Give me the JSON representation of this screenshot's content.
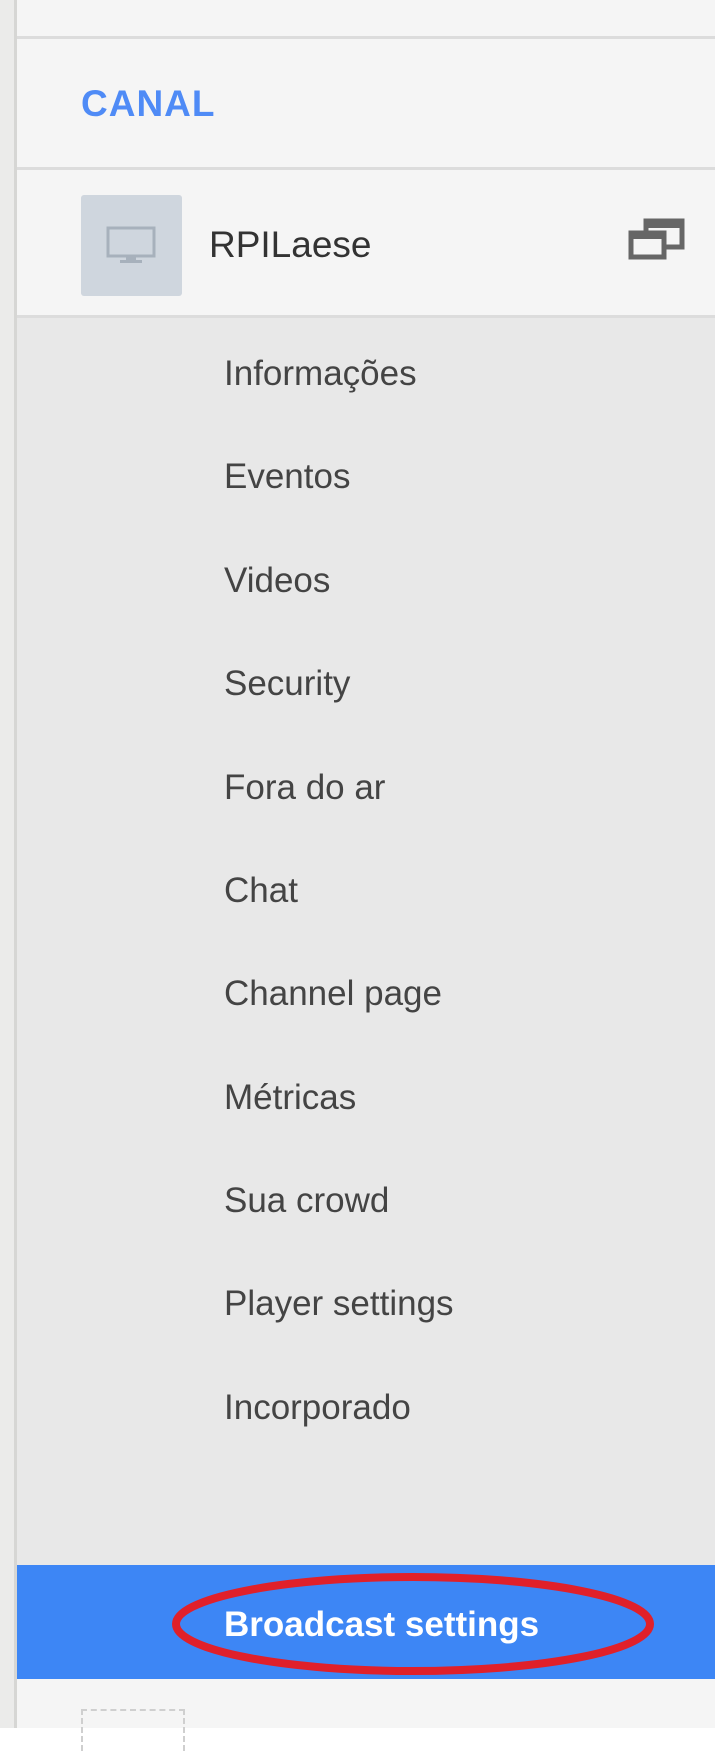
{
  "section": {
    "title": "CANAL"
  },
  "channel": {
    "name": "RPILaese",
    "avatar_icon": "monitor-icon",
    "popout_icon": "open-in-new-window-icon"
  },
  "menu": {
    "items": [
      {
        "label": "Informações"
      },
      {
        "label": "Eventos"
      },
      {
        "label": "Videos"
      },
      {
        "label": "Security"
      },
      {
        "label": "Fora do ar"
      },
      {
        "label": "Chat"
      },
      {
        "label": "Channel page"
      },
      {
        "label": "Métricas"
      },
      {
        "label": "Sua crowd"
      },
      {
        "label": "Player settings"
      },
      {
        "label": "Incorporado"
      }
    ],
    "active_item": {
      "label": "Broadcast settings"
    }
  },
  "colors": {
    "accent": "#4f8bf6",
    "active_bg": "#3d86f5",
    "highlight_annotation": "#e0202a",
    "menu_bg": "#e8e8e8",
    "panel_bg": "#f5f5f5"
  }
}
